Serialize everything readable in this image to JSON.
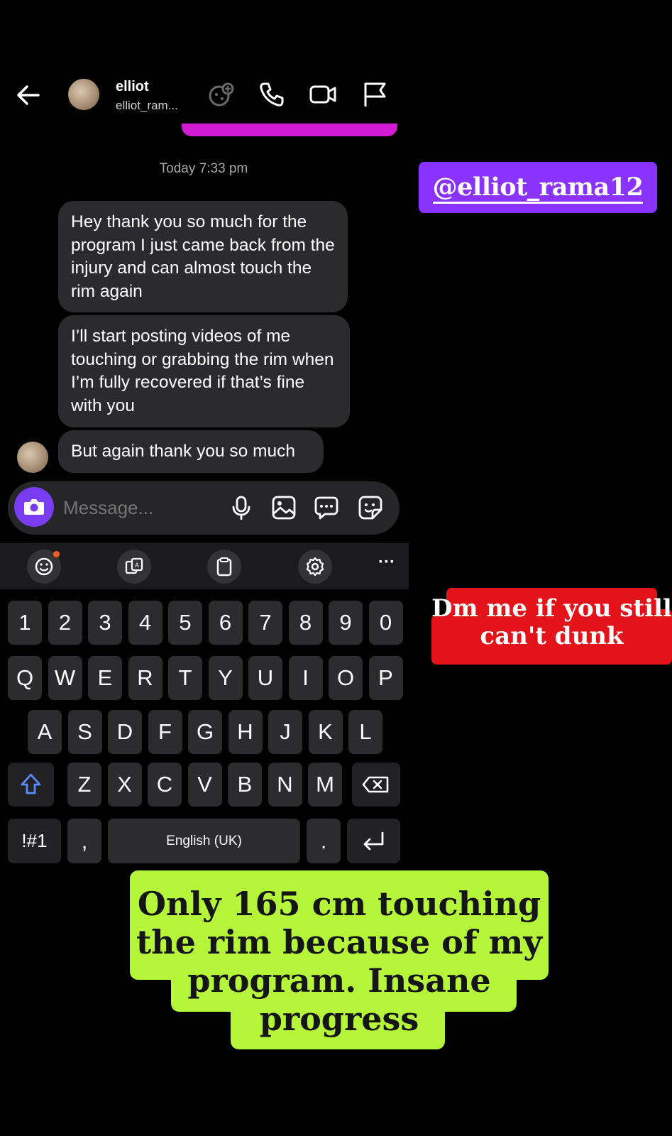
{
  "header": {
    "contact_name": "elliot",
    "contact_handle": "elliot_ram...",
    "icons": [
      "back-arrow-icon",
      "avatar",
      "effects-icon",
      "phone-icon",
      "video-icon",
      "flag-icon"
    ]
  },
  "chat": {
    "timestamp": "Today 7:33 pm",
    "messages": [
      {
        "text": "Hey thank you so much for the program I just came back from the injury and can almost touch the rim again"
      },
      {
        "text": "I’ll start posting videos of me touching or grabbing the rim when I’m fully recovered if that’s fine with you"
      },
      {
        "text": "But again thank you so much"
      }
    ]
  },
  "composer": {
    "placeholder": "Message...",
    "icons": [
      "camera-icon",
      "microphone-icon",
      "gallery-icon",
      "chat-bubble-icon",
      "sticker-icon"
    ]
  },
  "keyboard": {
    "toolbar_icons": [
      "emoji-icon",
      "translate-icon",
      "clipboard-icon",
      "settings-icon",
      "more-icon"
    ],
    "more_label": "···",
    "row_numbers": [
      "1",
      "2",
      "3",
      "4",
      "5",
      "6",
      "7",
      "8",
      "9",
      "0"
    ],
    "row_q": [
      "Q",
      "W",
      "E",
      "R",
      "T",
      "Y",
      "U",
      "I",
      "O",
      "P"
    ],
    "row_a": [
      "A",
      "S",
      "D",
      "F",
      "G",
      "H",
      "J",
      "K",
      "L"
    ],
    "row_z": [
      "Z",
      "X",
      "C",
      "V",
      "B",
      "N",
      "M"
    ],
    "symbols_label": "!#1",
    "comma_label": ",",
    "space_label": "English (UK)",
    "period_label": "."
  },
  "stickers": {
    "mention": "@elliot_rama12",
    "red_text": "Dm me if you still can't dunk",
    "green_text": "Only 165 cm touching the rim because of my program. Insane progress"
  },
  "colors": {
    "purple": "#8a33ff",
    "pink_bar": "#d41bd4",
    "red": "#e41219",
    "lime": "#b5f53a",
    "bubble": "#2b2b2d"
  }
}
